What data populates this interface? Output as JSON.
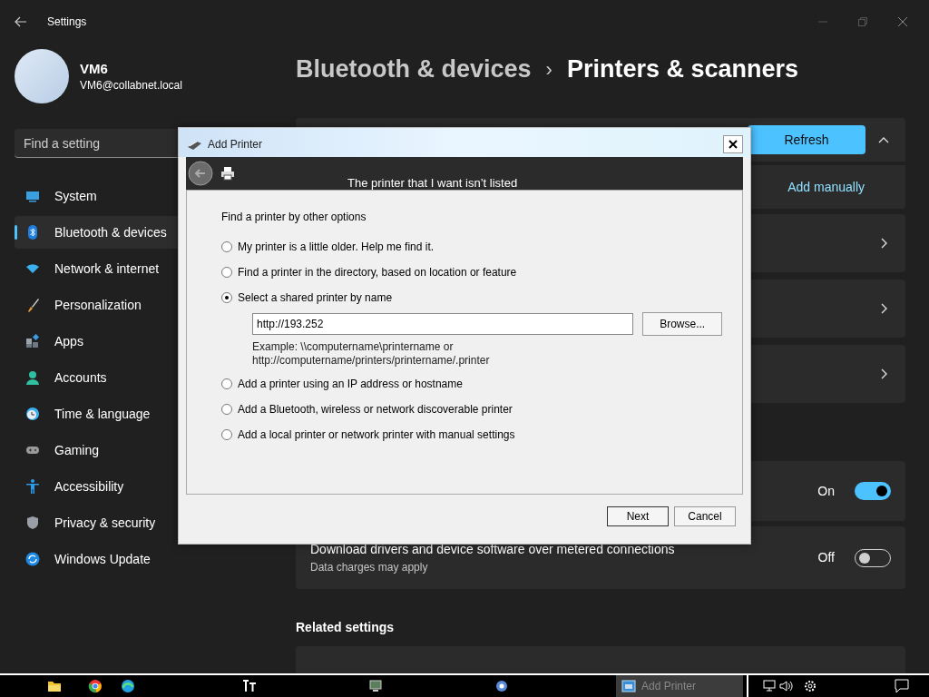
{
  "window": {
    "title": "Settings"
  },
  "account": {
    "name": "VM6",
    "email": "VM6@collabnet.local"
  },
  "search": {
    "placeholder": "Find a setting"
  },
  "nav": [
    {
      "label": "System",
      "selected": false
    },
    {
      "label": "Bluetooth & devices",
      "selected": true
    },
    {
      "label": "Network & internet",
      "selected": false
    },
    {
      "label": "Personalization",
      "selected": false
    },
    {
      "label": "Apps",
      "selected": false
    },
    {
      "label": "Accounts",
      "selected": false
    },
    {
      "label": "Time & language",
      "selected": false
    },
    {
      "label": "Gaming",
      "selected": false
    },
    {
      "label": "Accessibility",
      "selected": false
    },
    {
      "label": "Privacy & security",
      "selected": false
    },
    {
      "label": "Windows Update",
      "selected": false
    }
  ],
  "breadcrumb": {
    "parent": "Bluetooth & devices",
    "separator": "›",
    "current": "Printers & scanners"
  },
  "cards": [
    {
      "kind": "header",
      "button": "Refresh",
      "expanded": true
    },
    {
      "kind": "link",
      "link": "Add manually"
    },
    {
      "kind": "chevron"
    },
    {
      "kind": "chevron"
    },
    {
      "kind": "chevron"
    },
    {
      "kind": "toggle",
      "state": "On",
      "on": true
    },
    {
      "kind": "toggle",
      "title": "Download drivers and device software over metered connections",
      "subtitle": "Data charges may apply",
      "state": "Off",
      "on": false
    }
  ],
  "related": {
    "heading": "Related settings"
  },
  "dialog": {
    "title": "Add Printer",
    "header_text": "The printer that I want isn’t listed",
    "heading": "Find a printer by other options",
    "options": [
      {
        "label": "My printer is a little older. Help me find it.",
        "selected": false
      },
      {
        "label": "Find a printer in the directory, based on location or feature",
        "selected": false
      },
      {
        "label": "Select a shared printer by name",
        "selected": true,
        "field": {
          "value": "http://193.252",
          "button": "Browse...",
          "example": [
            "Example: \\\\computername\\printername or",
            "http://computername/printers/printername/.printer"
          ]
        }
      },
      {
        "label": "Add a printer using an IP address or hostname",
        "selected": false
      },
      {
        "label": "Add a Bluetooth, wireless or network discoverable printer",
        "selected": false
      },
      {
        "label": "Add a local printer or network printer with manual settings",
        "selected": false
      }
    ],
    "buttons": [
      "Next",
      "Cancel"
    ]
  },
  "taskbar": {
    "task": {
      "label": "Add Printer",
      "selected": true
    }
  }
}
